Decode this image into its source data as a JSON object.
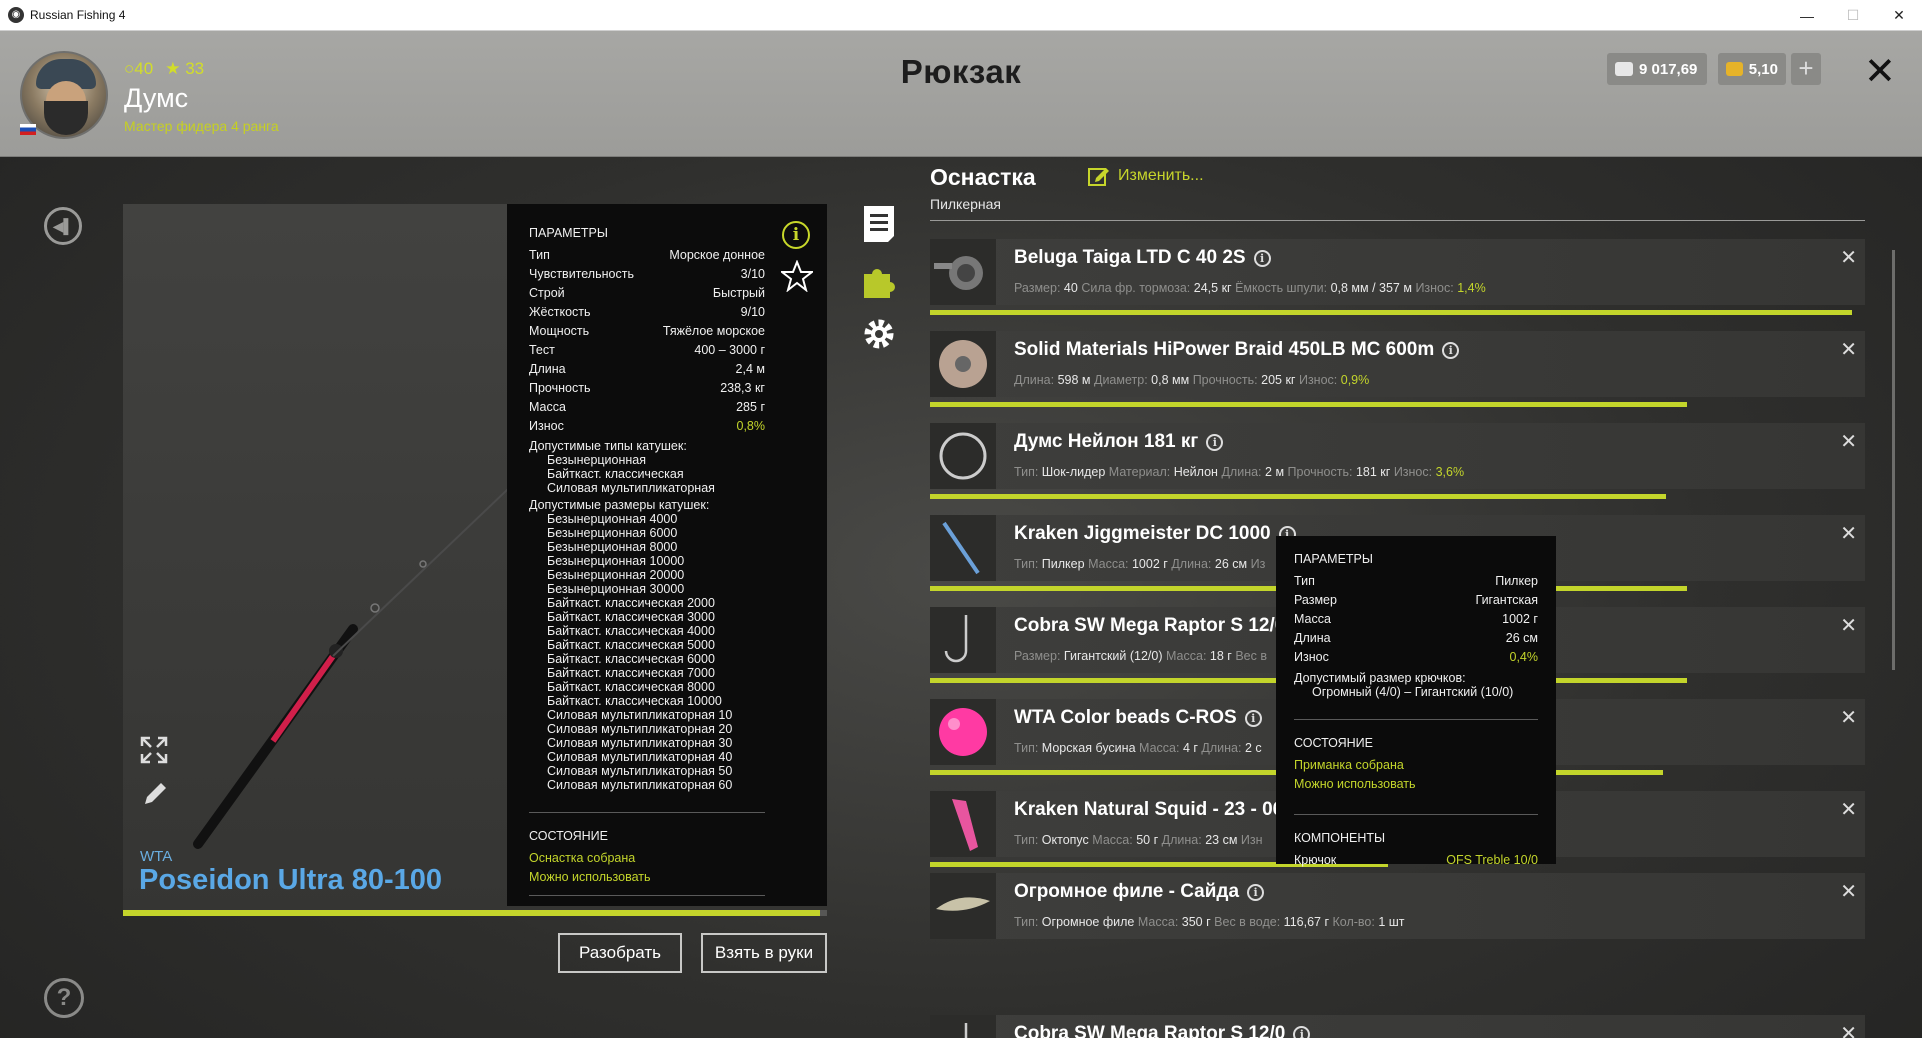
{
  "window": {
    "title": "Russian Fishing 4",
    "minimize": "—",
    "maximize": "☐",
    "close": "✕"
  },
  "header": {
    "player": {
      "coins": "40",
      "stars": "33",
      "name": "Думс",
      "rank": "Мастер фидера 4 ранга"
    },
    "title": "Рюкзак",
    "silver": "9 017,69",
    "gold": "5,10",
    "plus": "+",
    "close": "✕"
  },
  "rod": {
    "brand": "WTA",
    "name": "Poseidon Ultra 80-100",
    "progress": 0.99,
    "params_title": "ПАРАМЕТРЫ",
    "params": [
      {
        "k": "Тип",
        "v": "Морское донное"
      },
      {
        "k": "Чувствительность",
        "v": "3/10"
      },
      {
        "k": "Строй",
        "v": "Быстрый"
      },
      {
        "k": "Жёсткость",
        "v": "9/10"
      },
      {
        "k": "Мощность",
        "v": "Тяжёлое морское"
      },
      {
        "k": "Тест",
        "v": "400 – 3000 г"
      },
      {
        "k": "Длина",
        "v": "2,4 м"
      },
      {
        "k": "Прочность",
        "v": "238,3 кг"
      },
      {
        "k": "Масса",
        "v": "285 г"
      },
      {
        "k": "Износ",
        "v": "0,8%"
      }
    ],
    "reel_types_title": "Допустимые типы катушек:",
    "reel_types": [
      "Безынерционная",
      "Байткаст. классическая",
      "Силовая мультипликаторная"
    ],
    "reel_sizes_title": "Допустимые размеры катушек:",
    "reel_sizes": [
      "Безынерционная 4000",
      "Безынерционная 6000",
      "Безынерционная 8000",
      "Безынерционная 10000",
      "Безынерционная 20000",
      "Безынерционная 30000",
      "Байткаст. классическая 2000",
      "Байткаст. классическая 3000",
      "Байткаст. классическая 4000",
      "Байткаст. классическая 5000",
      "Байткаст. классическая 6000",
      "Байткаст. классическая 7000",
      "Байткаст. классическая 8000",
      "Байткаст. классическая 10000",
      "Силовая мультипликаторная 10",
      "Силовая мультипликаторная 20",
      "Силовая мультипликаторная 30",
      "Силовая мультипликаторная 40",
      "Силовая мультипликаторная 50",
      "Силовая мультипликаторная 60"
    ],
    "state_title": "СОСТОЯНИЕ",
    "state": [
      "Оснастка собрана",
      "Можно использовать"
    ],
    "info_glyph": "i"
  },
  "buttons": {
    "disassemble": "Разобрать",
    "take": "Взять в руки"
  },
  "tackle": {
    "title": "Оснастка",
    "subtitle": "Пилкерная",
    "change": "Изменить...",
    "items": [
      {
        "name": "Beluga Taiga LTD C 40 2S",
        "details": [
          [
            "Размер:",
            "40"
          ],
          [
            "Сила фр. тормоза:",
            "24,5 кг"
          ],
          [
            "Ёмкость шпули:",
            "0,8 мм / 357 м"
          ]
        ],
        "wear_label": "Износ:",
        "wear": "1,4%",
        "progress": 0.986
      },
      {
        "name": "Solid Materials HiPower Braid 450LB MC 600m",
        "details": [
          [
            "Длина:",
            "598 м"
          ],
          [
            "Диаметр:",
            "0,8 мм"
          ],
          [
            "Прочность:",
            "205 кг"
          ]
        ],
        "wear_label": "Износ:",
        "wear": "0,9%",
        "progress": 0.81
      },
      {
        "name": "Думс Нейлон 181 кг",
        "details": [
          [
            "Тип:",
            "Шок-лидер"
          ],
          [
            "Материал:",
            "Нейлон"
          ],
          [
            "Длина:",
            "2 м"
          ],
          [
            "Прочность:",
            "181 кг"
          ]
        ],
        "wear_label": "Износ:",
        "wear": "3,6%",
        "progress": 0.787
      },
      {
        "name": "Kraken Jiggmeister DC 1000",
        "details": [
          [
            "Тип:",
            "Пилкер"
          ],
          [
            "Масса:",
            "1002 г"
          ],
          [
            "Длина:",
            "26 см"
          ]
        ],
        "wear_label": "Из",
        "wear": "",
        "progress": 0.81
      },
      {
        "name": "Cobra SW Mega Raptor S 12/0",
        "details": [
          [
            "Размер:",
            "Гигантский (12/0)"
          ],
          [
            "Масса:",
            "18 г"
          ],
          [
            "Вес в",
            ""
          ]
        ],
        "wear_label": "",
        "wear": "",
        "progress": 0.81
      },
      {
        "name": "WTA Color beads C-ROS",
        "details": [
          [
            "Тип:",
            "Морская бусина"
          ],
          [
            "Масса:",
            "4 г"
          ],
          [
            "Длина:",
            "2 с"
          ]
        ],
        "wear_label": "",
        "wear": "",
        "progress": 0.784
      },
      {
        "name": "Kraken Natural Squid - 23 - 06",
        "details": [
          [
            "Тип:",
            "Октопус"
          ],
          [
            "Масса:",
            "50 г"
          ],
          [
            "Длина:",
            "23 см"
          ]
        ],
        "wear_label": "Изн",
        "wear": "",
        "progress": 0.49
      },
      {
        "name": "Огромное филе - Сайда",
        "details": [
          [
            "Тип:",
            "Огромное филе"
          ],
          [
            "Масса:",
            "350 г"
          ],
          [
            "Вес в воде:",
            "116,67 г"
          ],
          [
            "Кол-во:",
            "1 шт"
          ]
        ],
        "wear_label": "",
        "wear": "",
        "progress": 0
      },
      {
        "name": "Cobra SW Mega Raptor S 12/0",
        "details": [],
        "wear_label": "",
        "wear": "",
        "progress": 0
      }
    ],
    "close_glyph": "✕",
    "info_glyph": "i"
  },
  "tooltip": {
    "params_title": "ПАРАМЕТРЫ",
    "params": [
      {
        "k": "Тип",
        "v": "Пилкер"
      },
      {
        "k": "Размер",
        "v": "Гигантская"
      },
      {
        "k": "Масса",
        "v": "1002 г"
      },
      {
        "k": "Длина",
        "v": "26 см"
      },
      {
        "k": "Износ",
        "v": "0,4%"
      }
    ],
    "hook_title": "Допустимый размер крючков:",
    "hook_range": "Огромный (4/0) – Гигантский (10/0)",
    "state_title": "СОСТОЯНИЕ",
    "state": [
      "Приманка собрана",
      "Можно использовать"
    ],
    "components_title": "КОМПОНЕНТЫ",
    "components": [
      {
        "k": "Крючок",
        "v": "OFS Treble 10/0"
      }
    ]
  },
  "colors": {
    "accent": "#c3d52b",
    "rod_name": "#5aa8e6",
    "panel": "#0c0c0c"
  }
}
